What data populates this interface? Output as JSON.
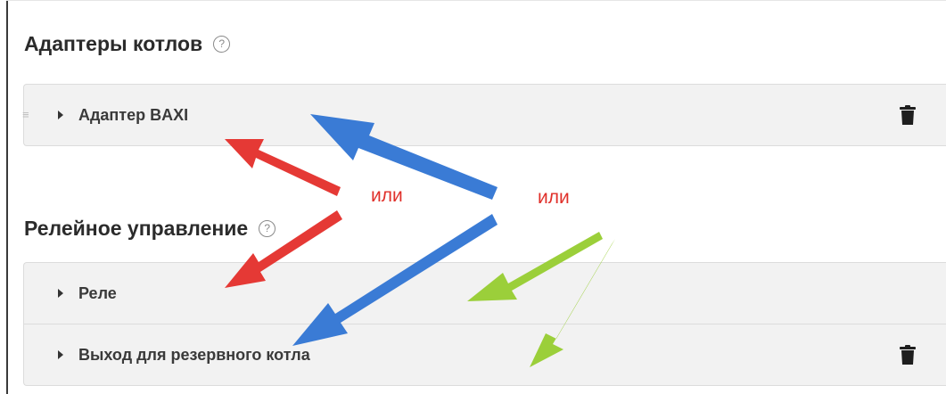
{
  "sections": [
    {
      "title": "Адаптеры котлов",
      "help": "?"
    },
    {
      "title": "Релейное управление",
      "help": "?"
    }
  ],
  "adapters": [
    {
      "label": "Адаптер BAXI"
    }
  ],
  "relays": [
    {
      "label": "Реле"
    },
    {
      "label": "Выход для резервного котла"
    }
  ],
  "annotations": {
    "left_or": "или",
    "right_or": "или"
  },
  "colors": {
    "red_arrow": "#e53935",
    "blue_arrow": "#3a7bd5",
    "green_arrow": "#9bcf3a"
  }
}
